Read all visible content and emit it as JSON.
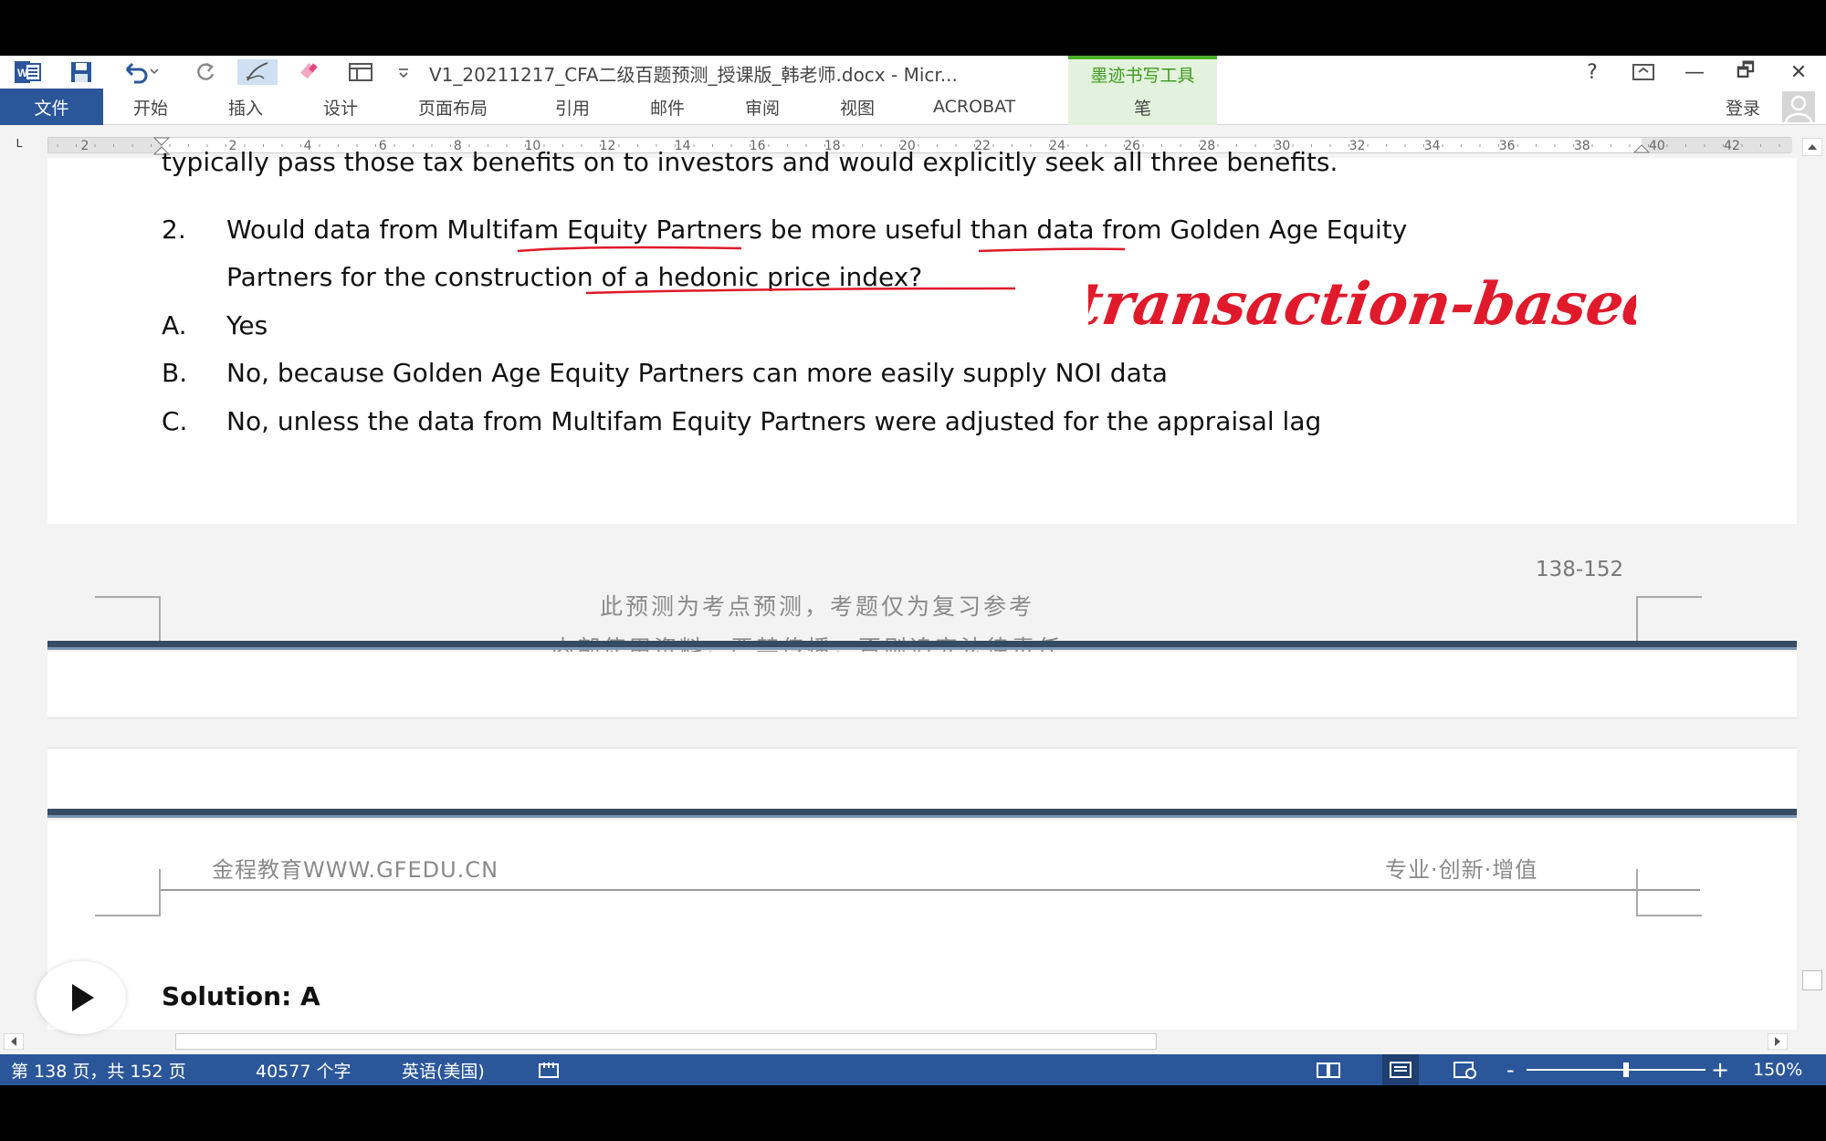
{
  "window": {
    "title": "V1_20211217_CFA二级百题预测_授课版_韩老师.docx - Micr...",
    "contextual_tab_group": "墨迹书写工具",
    "help_glyph": "?",
    "minimize_glyph": "—",
    "restore_glyph": "🗗",
    "close_glyph": "✕"
  },
  "ribbon": {
    "file_tab": "文件",
    "tabs": [
      "开始",
      "插入",
      "设计",
      "页面布局",
      "引用",
      "邮件",
      "审阅",
      "视图",
      "ACROBAT"
    ],
    "contextual_tab": "笔",
    "login": "登录"
  },
  "ruler": {
    "numbers": [
      "2",
      "2",
      "4",
      "6",
      "8",
      "10",
      "12",
      "14",
      "16",
      "18",
      "20",
      "22",
      "24",
      "26",
      "28",
      "30",
      "32",
      "34",
      "36",
      "38",
      "40",
      "42"
    ],
    "tab_selector": "L"
  },
  "document": {
    "carryover_line": "typically pass those tax benefits on to investors and would explicitly seek all three benefits.",
    "question": {
      "number": "2.",
      "line1": "Would data from Multifam Equity Partners be more useful than data from Golden Age Equity",
      "line2": "Partners for the construction of a hedonic price index?",
      "options": [
        {
          "letter": "A.",
          "text": "Yes"
        },
        {
          "letter": "B.",
          "text": "No, because Golden Age Equity Partners can more easily supply NOI data"
        },
        {
          "letter": "C.",
          "text": "No, unless the data from Multifam Equity Partners were adjusted for the appraisal lag"
        }
      ]
    },
    "handwritten_annotation": "transaction-based",
    "page_number": "138-152",
    "watermark_line1": "此预测为考点预测，考题仅为复习参考",
    "watermark_line2": "内部使用资料，严禁传播，否则追究法律责任",
    "header_left": "金程教育WWW.GFEDU.CN",
    "header_right": "专业·创新·增值",
    "next_heading": "Solution: A"
  },
  "statusbar": {
    "page_info": "第 138 页，共 152 页",
    "word_count": "40577 个字",
    "language": "英语(美国)",
    "zoom_minus": "-",
    "zoom_plus": "+",
    "zoom_level": "150%"
  },
  "colors": {
    "ribbon_blue": "#2b579a",
    "ink_red": "#e01a2b",
    "ink_tools_green": "#3c9a1e"
  }
}
